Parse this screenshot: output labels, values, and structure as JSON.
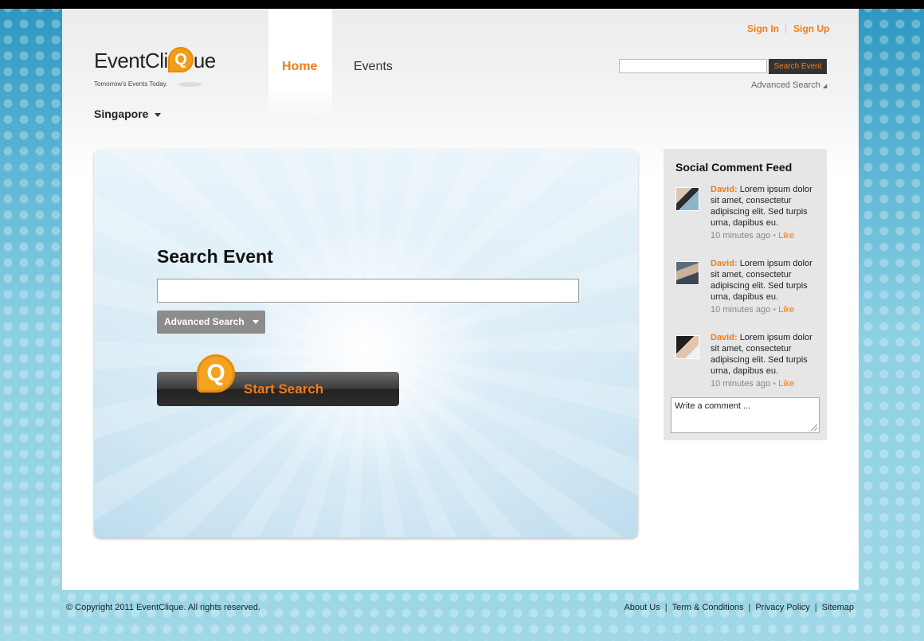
{
  "header": {
    "logo": {
      "name": "EventCliQue",
      "tagline": "Tomorrow's Events Today."
    },
    "nav": [
      {
        "label": "Home",
        "active": true
      },
      {
        "label": "Events",
        "active": false
      }
    ],
    "auth": {
      "sign_in": "Sign In",
      "separator": "|",
      "sign_up": "Sign Up"
    },
    "search": {
      "value": "",
      "button": "Search Event",
      "advanced": "Advanced Search"
    },
    "city": "Singapore"
  },
  "main": {
    "title": "Search Event",
    "search_value": "",
    "advanced_button": "Advanced Search",
    "start_button": "Start Search"
  },
  "sidebar": {
    "title": "Social Comment Feed",
    "comments": [
      {
        "author": "David:",
        "text": "Lorem ipsum dolor sit amet, consectetur adipiscing elit. Sed turpis urna, dapibus eu.",
        "time": "10 minutes ago",
        "like": "Like"
      },
      {
        "author": "David:",
        "text": "Lorem ipsum dolor sit amet, consectetur adipiscing elit. Sed turpis urna, dapibus eu.",
        "time": "10 minutes ago",
        "like": "Like"
      },
      {
        "author": "David:",
        "text": "Lorem ipsum dolor sit amet, consectetur adipiscing elit. Sed turpis urna, dapibus eu.",
        "time": "10 minutes ago",
        "like": "Like"
      }
    ],
    "comment_box": "Write a comment ..."
  },
  "footer": {
    "copyright": "© Copyright 2011 EventClique. All rights reserved.",
    "links": [
      "About Us",
      "Term & Conditions",
      "Privacy Policy",
      "Sitemap"
    ]
  },
  "colors": {
    "accent": "#f07d1a",
    "dark": "#333333",
    "background": "#8fd0e2"
  }
}
